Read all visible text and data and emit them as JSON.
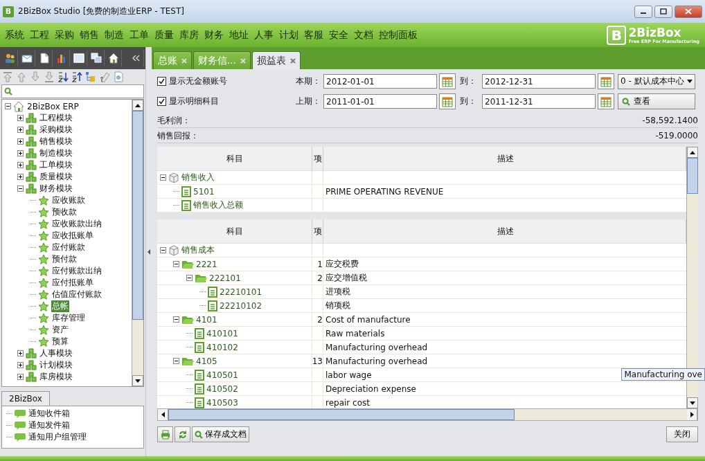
{
  "window": {
    "icon_mark": "B",
    "title": "2BizBox Studio [免费的制造业ERP - TEST]"
  },
  "menu": [
    "系统",
    "工程",
    "采购",
    "销售",
    "制造",
    "工单",
    "质量",
    "库房",
    "财务",
    "地址",
    "人事",
    "计划",
    "客服",
    "安全",
    "文档",
    "控制面板"
  ],
  "logo": {
    "mark": "B",
    "name": "2BizBox",
    "tagline": "Free ERP For Manufacturing"
  },
  "tabs": [
    {
      "label": "总账",
      "selected": false
    },
    {
      "label": "财务信...",
      "selected": false
    },
    {
      "label": "损益表",
      "selected": true
    }
  ],
  "sidebar": {
    "tree": [
      {
        "label": "2BizBox ERP",
        "kind": "home",
        "expanded": true,
        "selected": false,
        "children": [
          {
            "label": "工程模块",
            "kind": "module",
            "expanded": false,
            "selected": false
          },
          {
            "label": "采购模块",
            "kind": "module",
            "expanded": false,
            "selected": false
          },
          {
            "label": "销售模块",
            "kind": "module",
            "expanded": false,
            "selected": false
          },
          {
            "label": "制造模块",
            "kind": "module",
            "expanded": false,
            "selected": false
          },
          {
            "label": "工单模块",
            "kind": "module",
            "expanded": false,
            "selected": false
          },
          {
            "label": "质量模块",
            "kind": "module",
            "expanded": false,
            "selected": false
          },
          {
            "label": "财务模块",
            "kind": "module",
            "expanded": true,
            "selected": false,
            "children": [
              {
                "label": "应收账款",
                "kind": "function",
                "selected": false
              },
              {
                "label": "预收款",
                "kind": "function",
                "selected": false
              },
              {
                "label": "应收账款出纳",
                "kind": "function",
                "selected": false
              },
              {
                "label": "应收抵账单",
                "kind": "function",
                "selected": false
              },
              {
                "label": "应付账款",
                "kind": "function",
                "selected": false
              },
              {
                "label": "预付款",
                "kind": "function",
                "selected": false
              },
              {
                "label": "应付账款出纳",
                "kind": "function",
                "selected": false
              },
              {
                "label": "应付抵账单",
                "kind": "function",
                "selected": false
              },
              {
                "label": "估值应付账款",
                "kind": "function",
                "selected": false
              },
              {
                "label": "总帐",
                "kind": "function",
                "selected": true
              },
              {
                "label": "库存管理",
                "kind": "function",
                "selected": false
              },
              {
                "label": "资产",
                "kind": "function",
                "selected": false
              },
              {
                "label": "预算",
                "kind": "function",
                "selected": false
              }
            ]
          },
          {
            "label": "人事模块",
            "kind": "module",
            "expanded": false,
            "selected": false
          },
          {
            "label": "计划模块",
            "kind": "module",
            "expanded": false,
            "selected": false
          },
          {
            "label": "库房模块",
            "kind": "module",
            "expanded": false,
            "selected": false
          }
        ]
      }
    ],
    "bottom_tab": "2BizBox",
    "notifications": [
      {
        "label": "通知收件箱",
        "selected": false
      },
      {
        "label": "通知发件箱",
        "selected": false
      },
      {
        "label": "通知用户组管理",
        "selected": false
      }
    ]
  },
  "filters": {
    "options": [
      {
        "label": "显示无金额账号",
        "checked": true
      },
      {
        "label": "显示明细科目",
        "checked": true
      }
    ],
    "periods": [
      {
        "label": "本期：",
        "from": "2012-01-01",
        "to_label": "到：",
        "to": "2012-12-31"
      },
      {
        "label": "上期：",
        "from": "2011-01-01",
        "to_label": "到：",
        "to": "2011-12-31"
      }
    ],
    "cost_center": "0 - 默认成本中心",
    "view_button": "查看"
  },
  "summary": [
    {
      "label": "毛利润：",
      "value": "-58,592.1400"
    },
    {
      "label": "销售回报：",
      "value": "-519.0000"
    }
  ],
  "tables": [
    {
      "columns": [
        "科目",
        "项",
        "描述"
      ],
      "rows": [
        {
          "kind": "group",
          "code": "销售收入",
          "expanded": true,
          "children": [
            {
              "kind": "account",
              "code": "5101",
              "description": "PRIME OPERATING REVENUE"
            },
            {
              "kind": "account",
              "code": "销售收入总额"
            }
          ]
        }
      ]
    },
    {
      "columns": [
        "科目",
        "项",
        "描述"
      ],
      "rows": [
        {
          "kind": "group",
          "code": "销售成本",
          "expanded": true,
          "children": [
            {
              "kind": "folder",
              "code": "2221",
              "item": "1",
              "description": "应交税费",
              "expanded": true,
              "children": [
                {
                  "kind": "folder",
                  "code": "222101",
                  "item": "2",
                  "description": "应交增值税",
                  "expanded": true,
                  "children": [
                    {
                      "kind": "account",
                      "code": "22210101",
                      "description": "进项税"
                    },
                    {
                      "kind": "account",
                      "code": "22210102",
                      "description": "销项税"
                    }
                  ]
                }
              ]
            },
            {
              "kind": "folder",
              "code": "4101",
              "item": "2",
              "description": "Cost of manufacture",
              "expanded": true,
              "children": [
                {
                  "kind": "account",
                  "code": "410101",
                  "description": "Raw materials"
                },
                {
                  "kind": "account",
                  "code": "410102",
                  "description": "Manufacturing overhead"
                }
              ]
            },
            {
              "kind": "folder",
              "code": "4105",
              "item": "13",
              "description": "Manufacturing overhead",
              "expanded": true,
              "children": [
                {
                  "kind": "account",
                  "code": "410501",
                  "description": "labor wage"
                },
                {
                  "kind": "account",
                  "code": "410502",
                  "description": "Depreciation expense"
                },
                {
                  "kind": "account",
                  "code": "410503",
                  "description": "repair cost"
                }
              ]
            }
          ]
        }
      ]
    }
  ],
  "tooltip": "Manufacturing ove",
  "bottom_buttons": {
    "save": "保存成文档",
    "close": "关闭"
  }
}
